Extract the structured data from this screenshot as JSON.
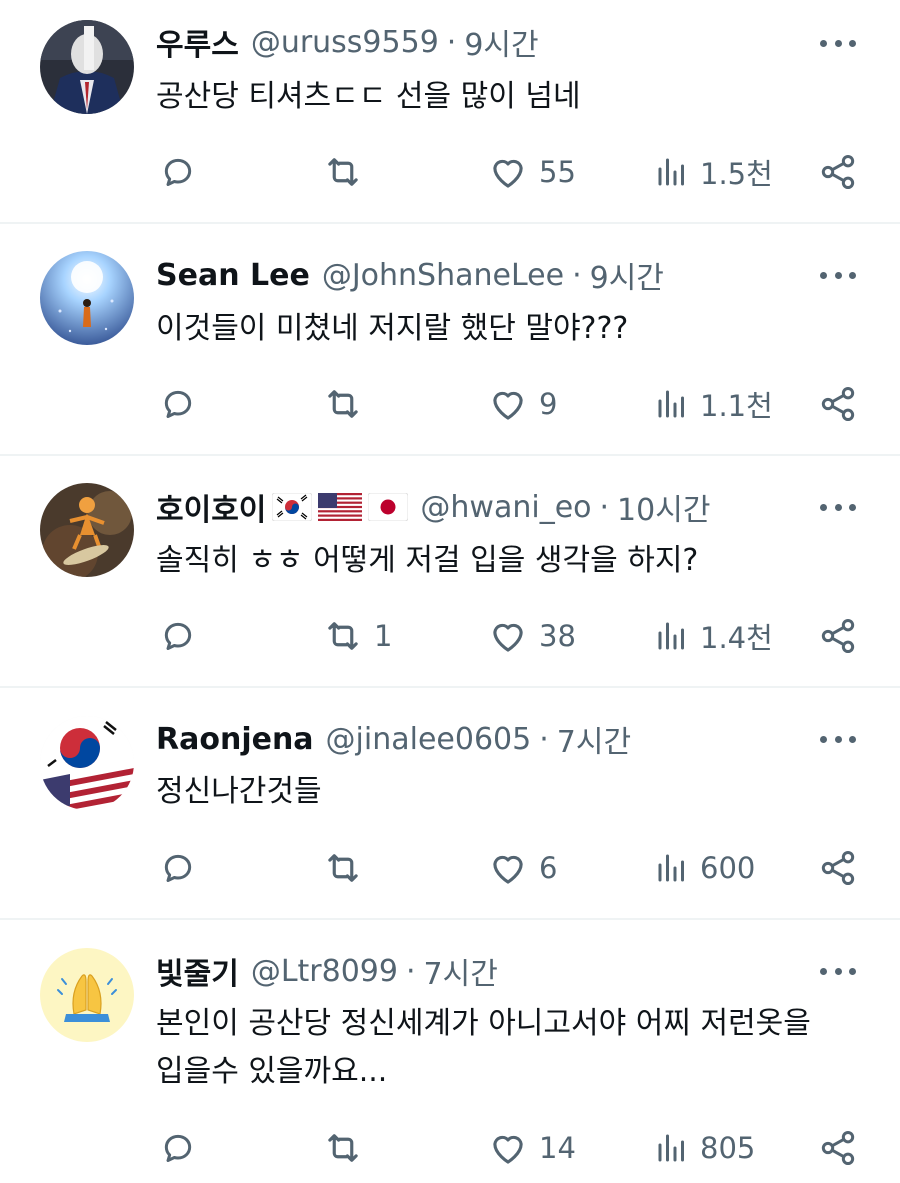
{
  "tweets": [
    {
      "name": "우루스",
      "handle": "@uruss9559",
      "separator": "·",
      "time": "9시간",
      "text": "공산당 티셔츠ㄷㄷ 선을 많이 넘네",
      "replies": "",
      "retweets": "",
      "likes": "55",
      "views": "1.5천",
      "avatar": "person-in-suit-avatar"
    },
    {
      "name": "Sean Lee",
      "handle": "@JohnShaneLee",
      "separator": "·",
      "time": "9시간",
      "text": "이것들이 미쳤네 저지랄 했단 말야???",
      "replies": "",
      "retweets": "",
      "likes": "9",
      "views": "1.1천",
      "avatar": "spirit-bomb-avatar"
    },
    {
      "name": "호이호이",
      "handle": "@hwani_eo",
      "separator": "·",
      "time": "10시간",
      "text": "솔직히 ㅎㅎ 어떻게 저걸 입을 생각을 하지?",
      "replies": "",
      "retweets": "1",
      "likes": "38",
      "views": "1.4천",
      "avatar": "surfing-figure-avatar",
      "flags": [
        "korea-flag",
        "usa-flag",
        "japan-flag"
      ]
    },
    {
      "name": "Raonjena",
      "handle": "@jinalee0605",
      "separator": "·",
      "time": "7시간",
      "text": "정신나간것들",
      "replies": "",
      "retweets": "",
      "likes": "6",
      "views": "600",
      "avatar": "korea-usa-flags-avatar"
    },
    {
      "name": "빛줄기",
      "handle": "@Ltr8099",
      "separator": "·",
      "time": "7시간",
      "text_lines": [
        "본인이 공산당 정신세계가 아니고서야 어찌 저런옷을",
        "입을수 있을까요..."
      ],
      "replies": "",
      "retweets": "",
      "likes": "14",
      "views": "805",
      "avatar": "praying-hands-avatar"
    }
  ],
  "colors": {
    "text": "#0f1419",
    "secondary": "#536471",
    "divider": "#eff3f4"
  }
}
